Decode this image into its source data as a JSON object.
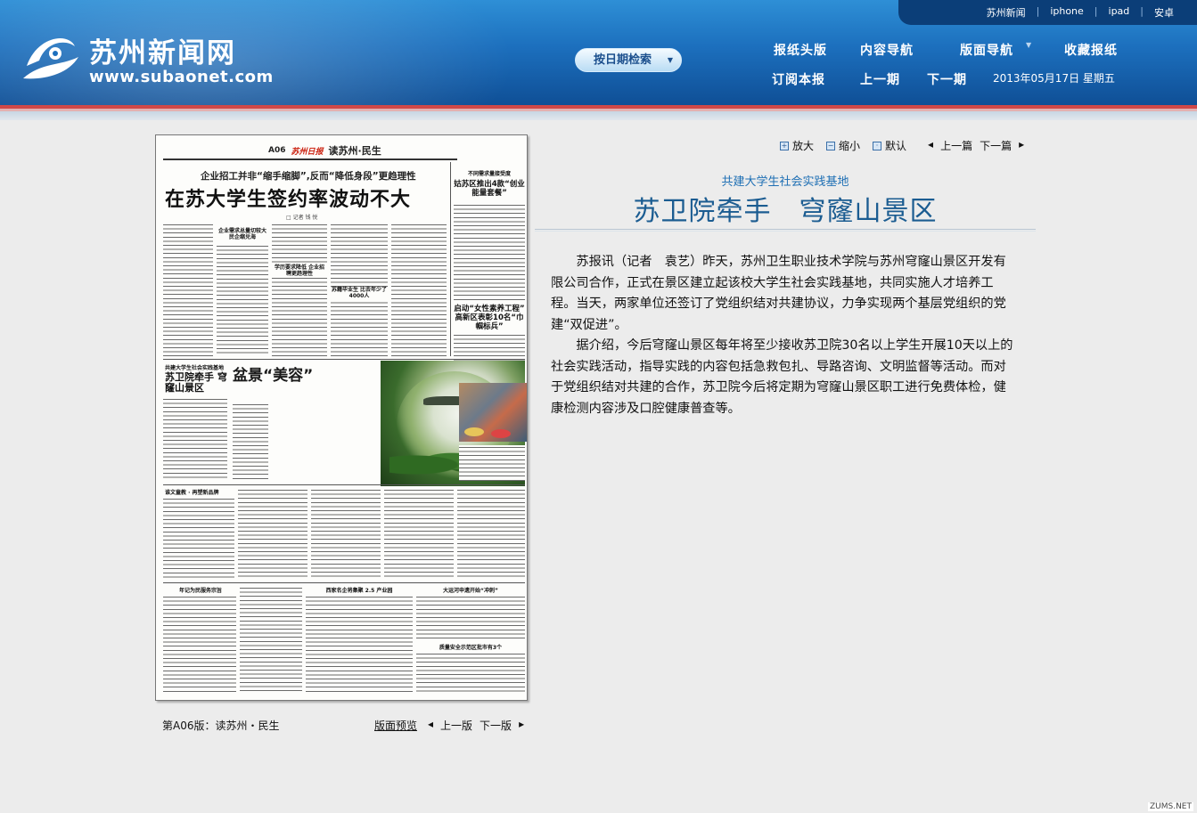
{
  "top_links": [
    "苏州新闻",
    "iphone",
    "ipad",
    "安卓"
  ],
  "brand": {
    "name": "苏州新闻网",
    "url": "www.subaonet.com"
  },
  "date_search": {
    "label": "按日期检索"
  },
  "nav": {
    "headlines": "报纸头版",
    "content_nav": "内容导航",
    "layout_nav": "版面导航",
    "layout_nav_arrow": "▼",
    "collect": "收藏报纸",
    "subscribe": "订阅本报",
    "prev_issue": "上一期",
    "next_issue": "下一期",
    "date": "2013年05月17日 星期五"
  },
  "paper": {
    "page_no": "A06",
    "masthead": "苏州日报",
    "section": "读苏州·民生",
    "subhead": "企业招工并非“缩手缩脚”,反而“降低身段”更趋理性",
    "headline": "在苏大学生签约率波动不大",
    "byline": "□ 记者 钱 悦",
    "kicker1": "企业需求总量切较大 民企缩兑海",
    "kicker2": "学历要求降低 企业招聘更趋理性",
    "kicker3": "苏籍毕业生 比去年少了4000人",
    "side_top": "不同需求量接受度",
    "side_head": "姑苏区推出4款“创业能量套餐”",
    "side_head2": "启动“女性素养工程” 高新区表彰10名“巾帼标兵”",
    "lower_kicker": "共建大学生社会实践基地",
    "lower_head": "苏卫院牵手 穹窿山景区",
    "penjing": "盆景“美容”",
    "news1": "谁文童教 · 再塑新品牌",
    "news2": "年记为民服务宗旨",
    "news3": "西家名企将集聚 2.5 产业园",
    "news4": "大运河申遗开始“冲刺”",
    "news5": "质量安全示范区批市有3个"
  },
  "caption": "第A06版：读苏州・民生",
  "page_preview": "版面预览",
  "page_prev": "上一版",
  "page_next": "下一版",
  "tools": {
    "zoom_in": "放大",
    "zoom_out": "缩小",
    "default": "默认",
    "prev_article": "上一篇",
    "next_article": "下一篇"
  },
  "article": {
    "subtitle": "共建大学生社会实践基地",
    "title": "苏卫院牵手　穹窿山景区",
    "paragraphs": [
      "苏报讯（记者　袁艺）昨天，苏州卫生职业技术学院与苏州穹窿山景区开发有限公司合作，正式在景区建立起该校大学生社会实践基地，共同实施人才培养工程。当天，两家单位还签订了党组织结对共建协议，力争实现两个基层党组织的党建“双促进”。",
      "据介绍，今后穹窿山景区每年将至少接收苏卫院30名以上学生开展10天以上的社会实践活动，指导实践的内容包括急救包扎、导路咨询、文明监督等活动。而对于党组织结对共建的合作，苏卫院今后将定期为穹窿山景区职工进行免费体检，健康检测内容涉及口腔健康普查等。"
    ]
  },
  "watermark": "ZUMS.NET",
  "colors": {
    "header_top": "#2e8fd6",
    "header_bottom": "#0f4f96",
    "stripe_red": "#d04848",
    "title_blue": "#1b5c91",
    "subtitle_blue": "#1e6fb4"
  }
}
